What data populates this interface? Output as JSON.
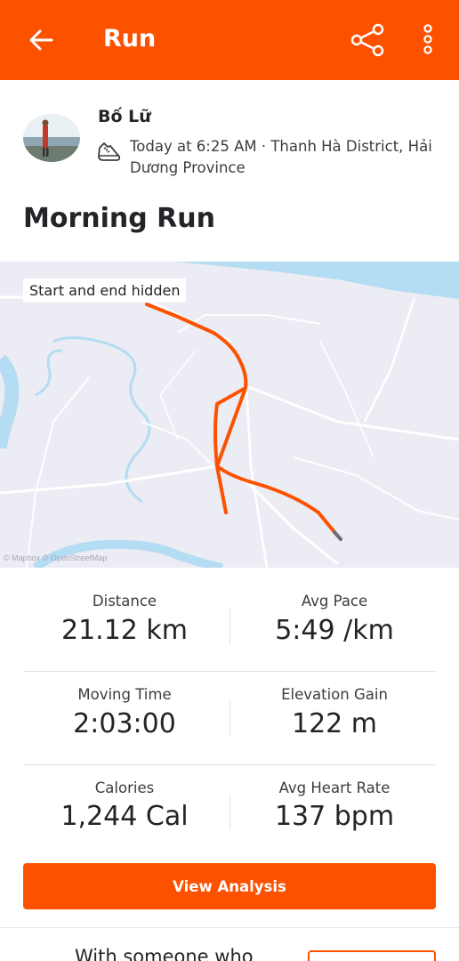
{
  "appbar": {
    "title": "Run",
    "back_icon": "arrow-left-icon",
    "share_icon": "share-icon",
    "more_icon": "more-vertical-icon",
    "color": "#fc5200"
  },
  "activity": {
    "athlete_name": "Bố Lữ",
    "sport_icon": "run-shoe-icon",
    "meta": "Today at 6:25 AM · Thanh Hà District, Hải Dương Province",
    "title": "Morning Run"
  },
  "map": {
    "badge": "Start and end hidden",
    "attribution": "© Mapbox © OpenStreetMap",
    "route_color": "#fc5200"
  },
  "stats": [
    {
      "label": "Distance",
      "value": "21.12 km"
    },
    {
      "label": "Avg Pace",
      "value": "5:49 /km"
    },
    {
      "label": "Moving Time",
      "value": "2:03:00"
    },
    {
      "label": "Elevation Gain",
      "value": "122 m"
    },
    {
      "label": "Calories",
      "value": "1,244 Cal"
    },
    {
      "label": "Avg Heart Rate",
      "value": "137 bpm"
    }
  ],
  "analysis_button": "View Analysis",
  "footer": {
    "text": "With someone who"
  }
}
